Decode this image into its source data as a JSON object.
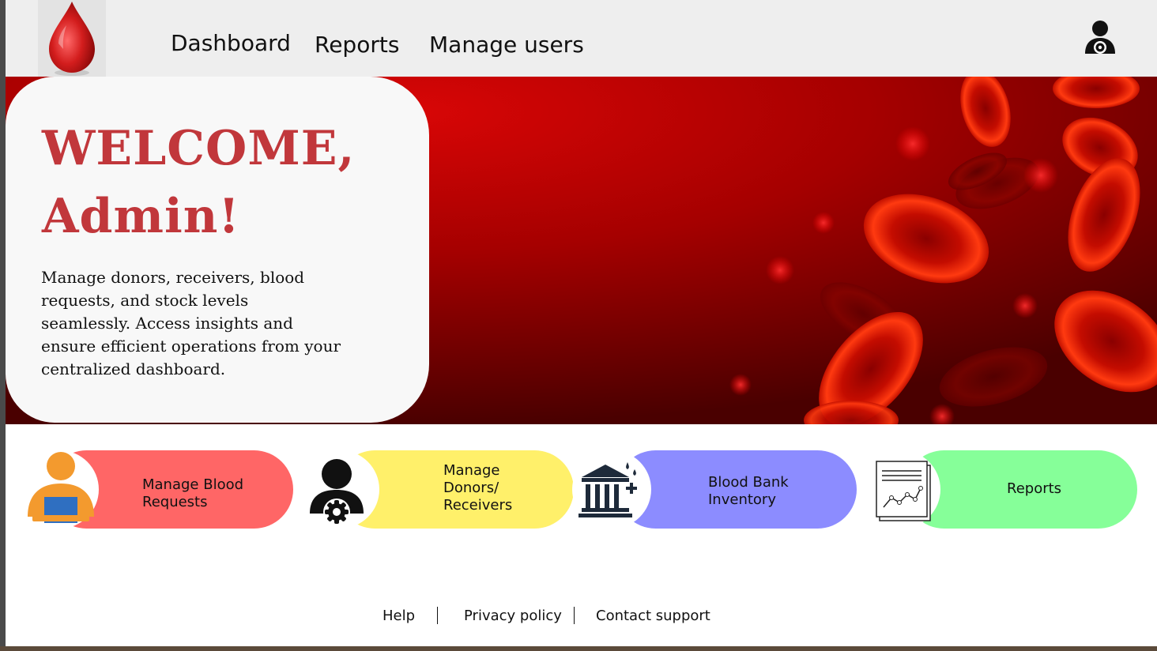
{
  "header": {
    "logo_icon": "blood-drop-icon",
    "nav": [
      "Dashboard",
      "Reports",
      "Manage users"
    ],
    "profile_icon": "admin-profile-icon"
  },
  "hero": {
    "welcome_line1": "WELCOME,",
    "welcome_line2": "Admin!",
    "description": " Manage donors, receivers, blood requests, and stock levels seamlessly. Access insights and ensure efficient operations from your centralized dashboard.",
    "background": "red-blood-cells-image"
  },
  "cards": [
    {
      "label": "Manage Blood\nRequests",
      "icon": "person-laptop-icon",
      "color": "#ff6666"
    },
    {
      "label": "Manage\nDonors/\nReceivers",
      "icon": "user-settings-icon",
      "color": "#fff06a"
    },
    {
      "label": "Blood Bank\nInventory",
      "icon": "blood-bank-building-icon",
      "color": "#8c8cff"
    },
    {
      "label": "Reports",
      "icon": "report-chart-icon",
      "color": "#86ff99"
    }
  ],
  "footer": {
    "links": [
      "Help",
      "Privacy policy",
      "Contact support"
    ]
  }
}
